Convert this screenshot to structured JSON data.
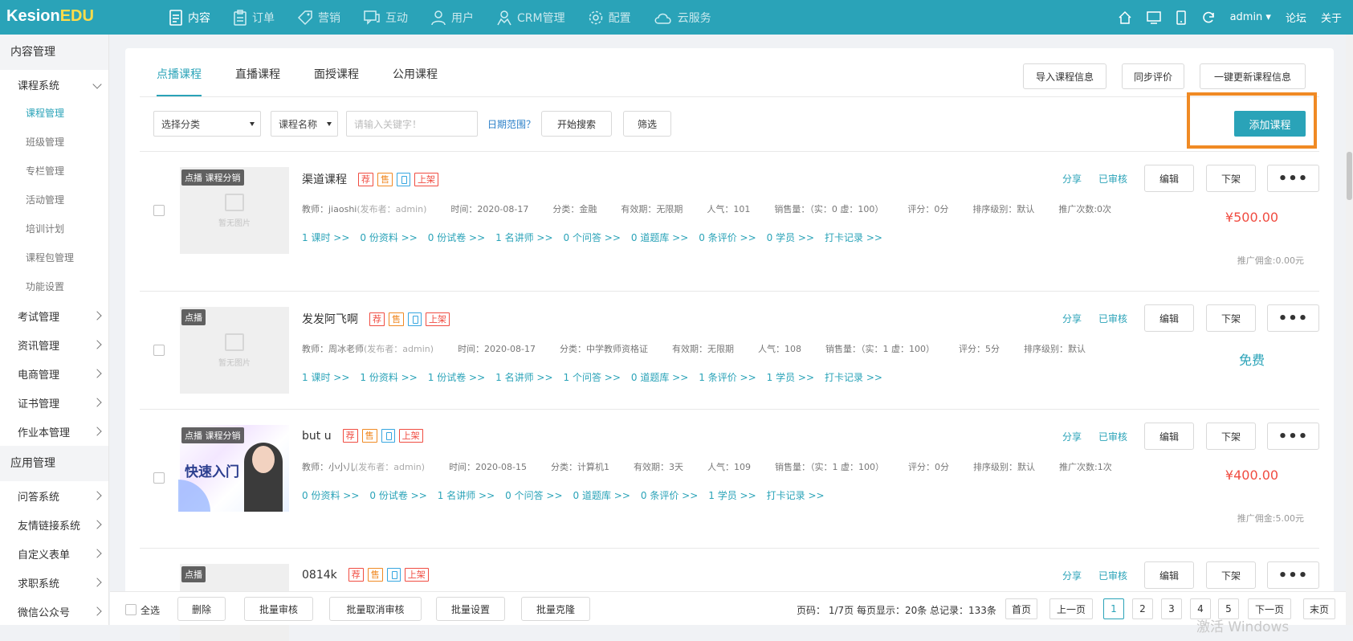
{
  "app": {
    "logo_a": "Kesion",
    "logo_b": "EDU"
  },
  "nav": [
    {
      "label": "内容",
      "icon": "document-icon"
    },
    {
      "label": "订单",
      "icon": "clipboard-icon"
    },
    {
      "label": "营销",
      "icon": "tag-icon"
    },
    {
      "label": "互动",
      "icon": "chat-icon"
    },
    {
      "label": "用户",
      "icon": "user-icon"
    },
    {
      "label": "CRM管理",
      "icon": "crm-user-icon"
    },
    {
      "label": "配置",
      "icon": "gear-icon"
    },
    {
      "label": "云服务",
      "icon": "cloud-icon"
    }
  ],
  "topright": {
    "user": "admin",
    "forum": "论坛",
    "about": "关于"
  },
  "sidebar": {
    "section1": "内容管理",
    "course_system": "课程系统",
    "sub": [
      "课程管理",
      "班级管理",
      "专栏管理",
      "活动管理",
      "培训计划",
      "课程包管理",
      "功能设置"
    ],
    "groups1": [
      "考试管理",
      "资讯管理",
      "电商管理",
      "证书管理",
      "作业本管理"
    ],
    "section2": "应用管理",
    "groups2": [
      "问答系统",
      "友情链接系统",
      "自定义表单",
      "求职系统",
      "微信公众号"
    ]
  },
  "tabs": [
    "点播课程",
    "直播课程",
    "面授课程",
    "公用课程"
  ],
  "toolbar": {
    "import": "导入课程信息",
    "sync": "同步评价",
    "update": "一键更新课程信息",
    "add": "添加课程"
  },
  "filters": {
    "category": "选择分类",
    "field": "课程名称",
    "keyword_placeholder": "请输入关键字！",
    "date_range": "日期范围？",
    "search": "开始搜索",
    "filter": "筛选"
  },
  "common": {
    "no_image": "暂无图片",
    "share": "分享",
    "audited": "已审核",
    "edit": "编辑",
    "offline": "下架",
    "more": "•••",
    "badge_rec": "荐",
    "badge_sale": "售",
    "badge_shelf": "上架"
  },
  "courses": [
    {
      "tag": "点播 课程分销",
      "name": "渠道课程",
      "teacher": "教师：jiaoshi",
      "publisher": "(发布者：admin)",
      "time": "时间：2020-08-17",
      "category": "分类：金融",
      "validity": "有效期：无限期",
      "popularity": "人气：101",
      "sales": "销售量：（实：0 虚：100）",
      "rating": "评分：0分",
      "sort": "排序级别：默认",
      "promo": "推广次数:0次",
      "links": [
        "1 课时 >>",
        "0 份资料 >>",
        "0 份试卷 >>",
        "1 名讲师 >>",
        "0 个问答 >>",
        "0 道题库 >>",
        "0 条评价 >>",
        "0 学员 >>",
        "打卡记录 >>"
      ],
      "price": "¥500.00",
      "commission": "推广佣金:0.00元",
      "has_image": false
    },
    {
      "tag": "点播",
      "name": "发发阿飞啊",
      "teacher": "教师：周冰老师",
      "publisher": "(发布者：admin)",
      "time": "时间：2020-08-17",
      "category": "分类：中学教师资格证",
      "validity": "有效期：无限期",
      "popularity": "人气：108",
      "sales": "销售量：（实：1 虚：100）",
      "rating": "评分：5分",
      "sort": "排序级别：默认",
      "promo": "",
      "links": [
        "1 课时 >>",
        "1 份资料 >>",
        "1 份试卷 >>",
        "1 名讲师 >>",
        "1 个问答 >>",
        "0 道题库 >>",
        "1 条评价 >>",
        "1 学员 >>",
        "打卡记录 >>"
      ],
      "price": "免费",
      "commission": "",
      "has_image": false
    },
    {
      "tag": "点播 课程分销",
      "name": "but u",
      "teacher": "教师：小小儿",
      "publisher": "(发布者：admin)",
      "time": "时间：2020-08-15",
      "category": "分类：计算机1",
      "validity": "有效期：3天",
      "popularity": "人气：109",
      "sales": "销售量：（实：1 虚：100）",
      "rating": "评分：0分",
      "sort": "排序级别：默认",
      "promo": "推广次数:1次",
      "links": [
        "0 份资料 >>",
        "0 份试卷 >>",
        "1 名讲师 >>",
        "0 个问答 >>",
        "0 道题库 >>",
        "0 条评价 >>",
        "1 学员 >>",
        "打卡记录 >>"
      ],
      "price": "¥400.00",
      "commission": "推广佣金:5.00元",
      "has_image": true,
      "cover_text": "快速入门"
    },
    {
      "tag": "点播",
      "name": "0814k",
      "has_image": false
    }
  ],
  "bottom": {
    "select_all": "全选",
    "delete": "删除",
    "batch_audit": "批量审核",
    "batch_unaudit": "批量取消审核",
    "batch_settings": "批量设置",
    "batch_clone": "批量克隆",
    "page_info": "页码： 1/7页 每页显示：20条 总记录：133条",
    "first": "首页",
    "prev": "上一页",
    "pages": [
      "1",
      "2",
      "3",
      "4",
      "5"
    ],
    "next": "下一页",
    "last": "末页"
  },
  "watermark": "激活 Windows"
}
